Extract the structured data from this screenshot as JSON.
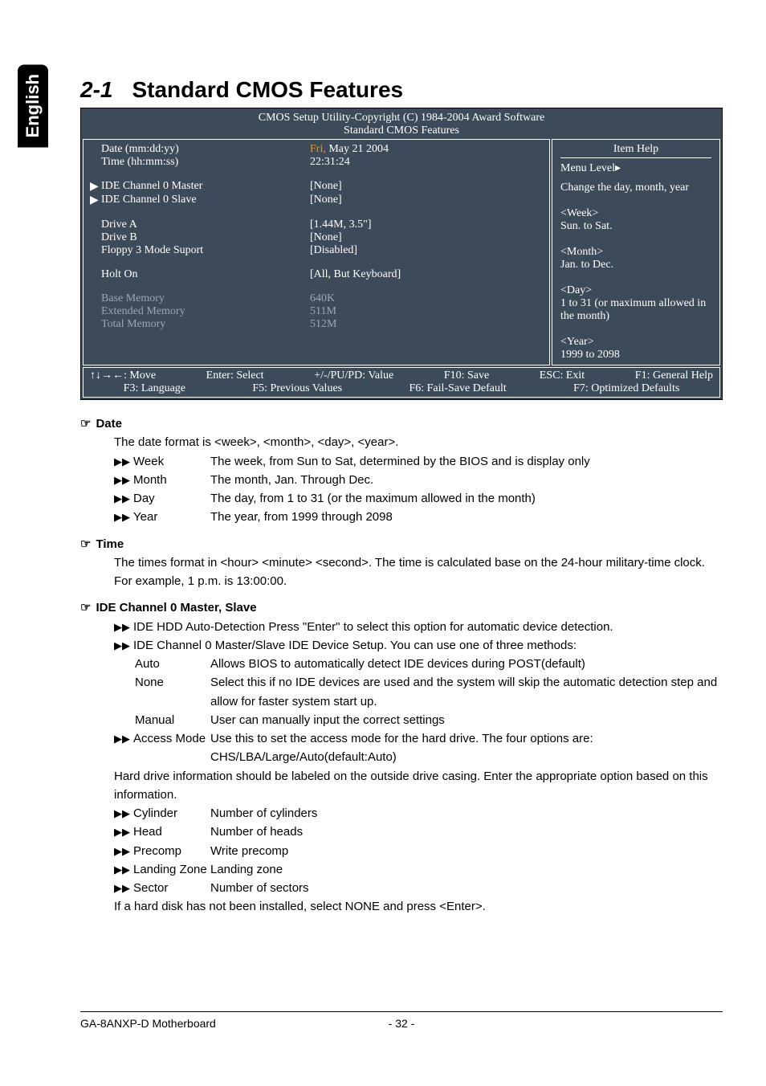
{
  "sideTab": "English",
  "section": {
    "num": "2-1",
    "title": "Standard CMOS Features"
  },
  "bios": {
    "headerLine1": "CMOS Setup Utility-Copyright (C) 1984-2004 Award Software",
    "headerLine2": "Standard CMOS Features",
    "rows": [
      {
        "tri": "",
        "label": "Date (mm:dd:yy)",
        "val": "Fri, May  21  2004",
        "orange": true
      },
      {
        "tri": "",
        "label": "Time (hh:mm:ss)",
        "val": "22:31:24"
      },
      {
        "spacer": true
      },
      {
        "tri": "▶",
        "label": "IDE Channel 0 Master",
        "val": "[None]"
      },
      {
        "tri": "▶",
        "label": "IDE Channel 0 Slave",
        "val": "[None]"
      },
      {
        "spacer": true
      },
      {
        "tri": "",
        "label": "Drive A",
        "val": "[1.44M, 3.5\"]"
      },
      {
        "tri": "",
        "label": "Drive B",
        "val": "[None]"
      },
      {
        "tri": "",
        "label": "Floppy 3 Mode Suport",
        "val": "[Disabled]"
      },
      {
        "spacer": true
      },
      {
        "tri": "",
        "label": "Holt On",
        "val": "[All, But Keyboard]"
      },
      {
        "spacer": true
      },
      {
        "tri": "",
        "label": "Base Memory",
        "val": "640K",
        "dim": true
      },
      {
        "tri": "",
        "label": "Extended Memory",
        "val": "511M",
        "dim": true
      },
      {
        "tri": "",
        "label": "Total Memory",
        "val": "512M",
        "dim": true
      },
      {
        "spacer": true
      },
      {
        "spacer": true
      }
    ],
    "help": {
      "title": "Item Help",
      "menuLevel": "Menu Level▸",
      "lines": [
        "Change the day, month, year",
        "",
        "<Week>",
        "Sun. to Sat.",
        "",
        "<Month>",
        "Jan. to Dec.",
        "",
        "<Day>",
        "1 to 31 (or maximum allowed in the month)",
        "",
        "<Year>",
        "1999 to 2098"
      ]
    },
    "footer1": [
      "↑↓→←: Move",
      "Enter: Select",
      "+/-/PU/PD: Value",
      "F10: Save",
      "ESC: Exit",
      "F1: General Help"
    ],
    "footer2": [
      "F3: Language",
      "F5: Previous Values",
      "F6: Fail-Save Default",
      "F7: Optimized Defaults"
    ]
  },
  "doc": {
    "dateTitle": "Date",
    "dateIntro": "The date format is <week>, <month>, <day>, <year>.",
    "dateItems": [
      {
        "term": "Week",
        "def": "The week, from Sun to Sat, determined by the BIOS and is display only"
      },
      {
        "term": "Month",
        "def": "The month, Jan. Through Dec."
      },
      {
        "term": "Day",
        "def": "The day, from 1 to 31 (or the maximum allowed in the month)"
      },
      {
        "term": "Year",
        "def": "The year, from 1999 through 2098"
      }
    ],
    "timeTitle": "Time",
    "timeBody": "The times format in <hour> <minute> <second>. The time is calculated base on the 24-hour military-time clock. For example, 1 p.m. is 13:00:00.",
    "ideTitle": "IDE Channel 0 Master, Slave",
    "ideLine1": "IDE HDD Auto-Detection Press \"Enter\" to select this option for automatic device detection.",
    "ideLine2": "IDE Channel 0 Master/Slave IDE Device Setup.  You can use one of three methods:",
    "ideMethods": [
      {
        "term": "Auto",
        "def": "Allows BIOS to automatically detect IDE devices during POST(default)"
      },
      {
        "term": "None",
        "def": "Select this if no IDE devices are used and the system will skip the automatic detection step and allow for faster system start up."
      },
      {
        "term": "Manual",
        "def": "User can manually input the correct settings"
      }
    ],
    "accessTerm": "Access Mode",
    "accessDef": "Use this to set the access mode for the hard drive. The four options are: CHS/LBA/Large/Auto(default:Auto)",
    "hdNote": "Hard drive information should be labeled on the outside drive casing.  Enter the appropriate option based on this information.",
    "hdItems": [
      {
        "term": "Cylinder",
        "def": "Number of cylinders"
      },
      {
        "term": "Head",
        "def": "Number of heads"
      },
      {
        "term": "Precomp",
        "def": "Write precomp"
      },
      {
        "term": "Landing Zone",
        "def": "Landing zone"
      },
      {
        "term": "Sector",
        "def": "Number of sectors"
      }
    ],
    "hdTail": "If a hard disk has not been installed, select NONE and press <Enter>."
  },
  "footer": {
    "left": "GA-8ANXP-D Motherboard",
    "center": "- 32 -"
  }
}
